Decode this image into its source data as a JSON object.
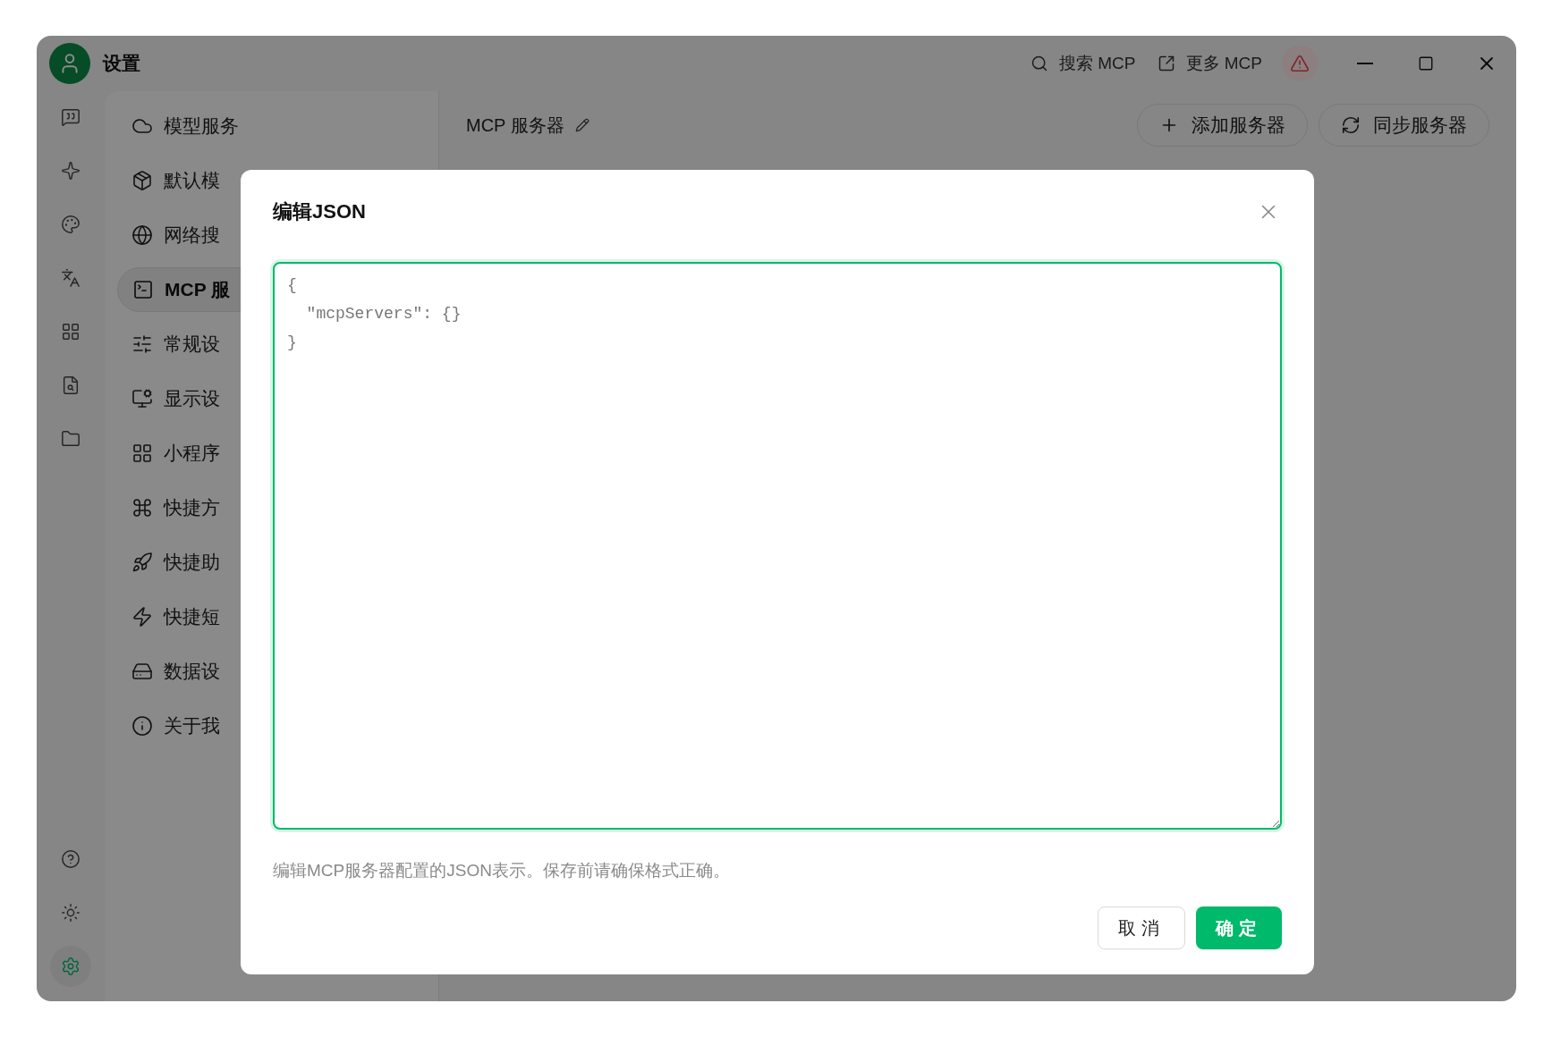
{
  "window": {
    "title": "设置",
    "controls": [
      {
        "kind": "minimize"
      },
      {
        "kind": "maximize"
      },
      {
        "kind": "close"
      }
    ]
  },
  "topbar": {
    "actions": [
      {
        "kind": "search",
        "label": "搜索 MCP"
      },
      {
        "kind": "external",
        "label": "更多 MCP"
      },
      {
        "kind": "warning"
      }
    ]
  },
  "rail": {
    "items": [
      {
        "kind": "chat",
        "selected": false
      },
      {
        "kind": "sparkle",
        "selected": false
      },
      {
        "kind": "palette",
        "selected": false
      },
      {
        "kind": "translate",
        "selected": false
      },
      {
        "kind": "apps",
        "selected": false
      },
      {
        "kind": "file-search",
        "selected": false
      },
      {
        "kind": "folder",
        "selected": false
      }
    ],
    "bottom": [
      {
        "kind": "help",
        "selected": false
      },
      {
        "kind": "theme",
        "selected": false
      },
      {
        "kind": "settings",
        "selected": true
      }
    ]
  },
  "nav": {
    "items": [
      {
        "kind": "cloud",
        "label": "模型服务",
        "selected": false
      },
      {
        "kind": "package",
        "label": "默认模",
        "selected": false
      },
      {
        "kind": "globe",
        "label": "网络搜",
        "selected": false
      },
      {
        "kind": "terminal",
        "label": "MCP 服",
        "selected": true
      },
      {
        "kind": "sliders",
        "label": "常规设",
        "selected": false
      },
      {
        "kind": "monitor",
        "label": "显示设",
        "selected": false
      },
      {
        "kind": "grid",
        "label": "小程序",
        "selected": false
      },
      {
        "kind": "command",
        "label": "快捷方",
        "selected": false
      },
      {
        "kind": "rocket",
        "label": "快捷助",
        "selected": false
      },
      {
        "kind": "zap",
        "label": "快捷短",
        "selected": false
      },
      {
        "kind": "drive",
        "label": "数据设",
        "selected": false
      },
      {
        "kind": "info",
        "label": "关于我",
        "selected": false
      }
    ]
  },
  "page": {
    "title": "MCP 服务器",
    "buttons": [
      {
        "kind": "add",
        "label": "添加服务器"
      },
      {
        "kind": "sync",
        "label": "同步服务器"
      }
    ]
  },
  "dialog": {
    "title": "编辑JSON",
    "editor": {
      "value": "{\n  \"mcpServers\": {}\n}"
    },
    "hint": "编辑MCP服务器配置的JSON表示。保存前请确保格式正确。",
    "buttons": [
      {
        "kind": "cancel",
        "label": "取消"
      },
      {
        "kind": "primary",
        "label": "确定"
      }
    ]
  }
}
